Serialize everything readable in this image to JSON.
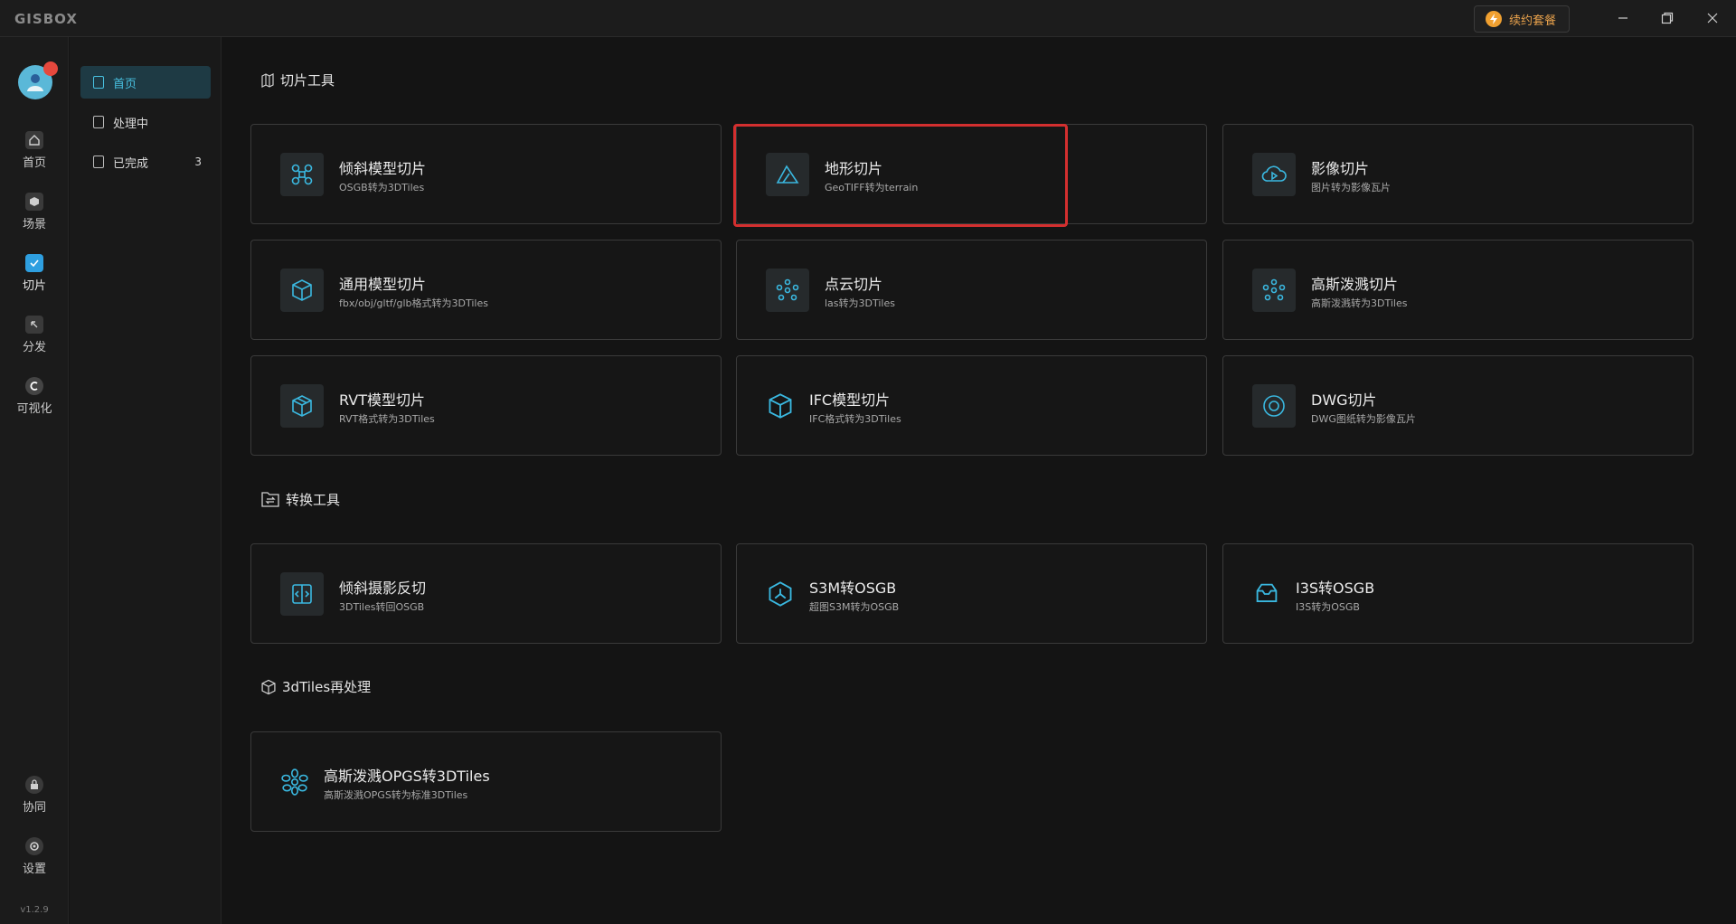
{
  "app": {
    "logo": "GISBOX",
    "renew_label": "续约套餐",
    "version": "v1.2.9"
  },
  "rail": [
    {
      "label": "首页"
    },
    {
      "label": "场景"
    },
    {
      "label": "切片"
    },
    {
      "label": "分发"
    },
    {
      "label": "可视化"
    },
    {
      "label": "协同"
    },
    {
      "label": "设置"
    }
  ],
  "subnav": [
    {
      "label": "首页"
    },
    {
      "label": "处理中"
    },
    {
      "label": "已完成",
      "count": "3"
    }
  ],
  "sections": {
    "slicing": "切片工具",
    "conversion": "转换工具",
    "reprocess": "3dTiles再处理"
  },
  "cards": [
    {
      "title": "倾斜模型切片",
      "desc": "OSGB转为3DTiles",
      "icon": "drone-icon"
    },
    {
      "title": "地形切片",
      "desc": "GeoTIFF转为terrain",
      "icon": "mountain-icon"
    },
    {
      "title": "影像切片",
      "desc": "图片转为影像瓦片",
      "icon": "cloud-play-icon"
    },
    {
      "title": "通用模型切片",
      "desc": "fbx/obj/gltf/glb格式转为3DTiles",
      "icon": "cube-icon"
    },
    {
      "title": "点云切片",
      "desc": "las转为3DTiles",
      "icon": "point-cloud-icon"
    },
    {
      "title": "高斯泼溅切片",
      "desc": "高斯泼溅转为3DTiles",
      "icon": "gaussian-icon"
    },
    {
      "title": "RVT模型切片",
      "desc": "RVT格式转为3DTiles",
      "icon": "cubes-icon"
    },
    {
      "title": "IFC模型切片",
      "desc": "IFC格式转为3DTiles",
      "icon": "ifc-cube-icon"
    },
    {
      "title": "DWG切片",
      "desc": "DWG图纸转为影像瓦片",
      "icon": "dwg-ring-icon"
    },
    {
      "title": "倾斜摄影反切",
      "desc": "3DTiles转回OSGB",
      "icon": "reverse-slice-icon"
    },
    {
      "title": "S3M转OSGB",
      "desc": "超图S3M转为OSGB",
      "icon": "hexagon-icon"
    },
    {
      "title": "I3S转OSGB",
      "desc": "I3S转为OSGB",
      "icon": "box-open-icon"
    },
    {
      "title": "高斯泼溅OPGS转3DTiles",
      "desc": "高斯泼溅OPGS转为标准3DTiles",
      "icon": "flower-icon"
    }
  ]
}
